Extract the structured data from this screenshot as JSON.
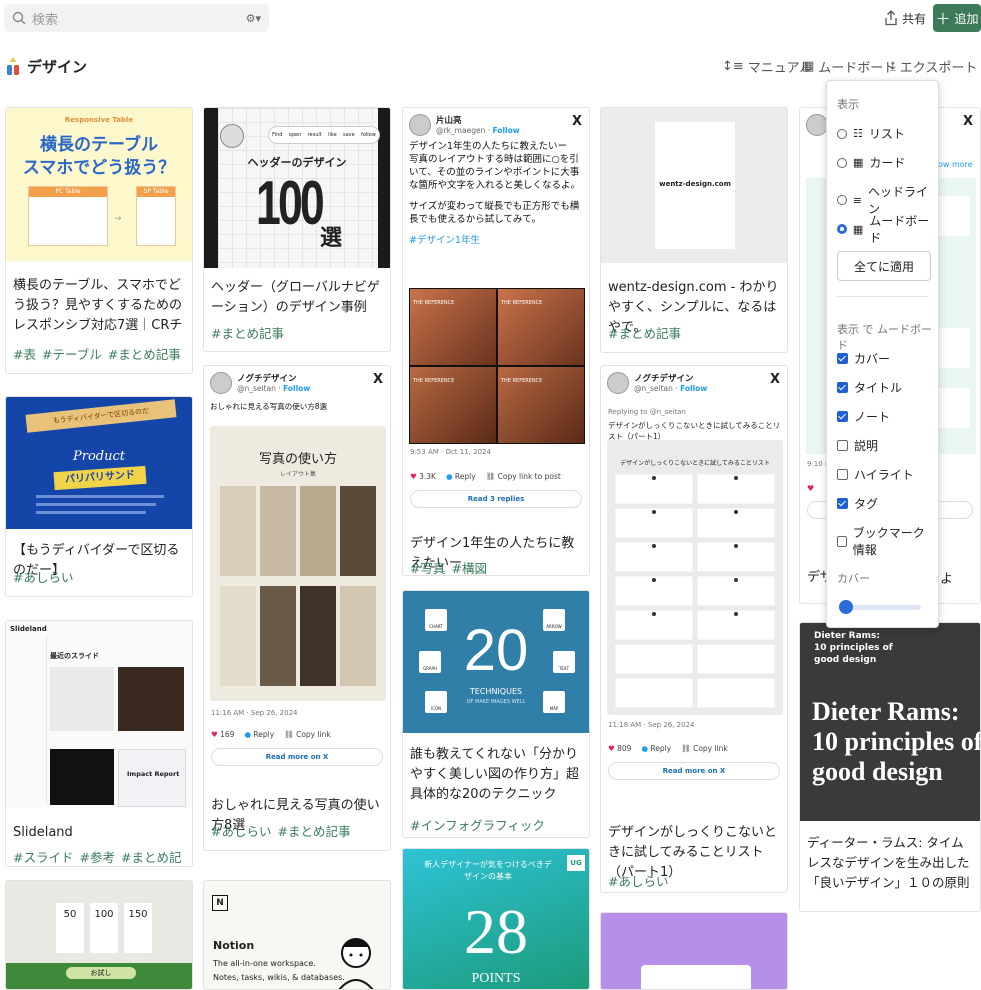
{
  "header": {
    "search_placeholder": "検索",
    "share_label": "共有",
    "add_label": "追加"
  },
  "page": {
    "title": "デザイン",
    "sort_label": "マニュアル",
    "view_label": "ムードボード",
    "export_label": "エクスポート"
  },
  "cards": {
    "c1": {
      "cover_small": "Responsive Table",
      "cover_big1": "横長のテーブル",
      "cover_big2": "スマホでどう扱う？",
      "cover_pc": "PC Table",
      "cover_sp": "SP Table",
      "title": "横長のテーブル、スマホでどう扱う？見やすくするためのレスポンシブ対応7選｜CRチーム@株式会社メタフェ...",
      "tags": [
        "#表",
        "#テーブル",
        "#まとめ記事"
      ]
    },
    "c2": {
      "cover_caption": "ヘッダーのデザイン",
      "cover_num": "100",
      "cover_suffix": "選",
      "nav": [
        "Find",
        "open",
        "result",
        "like",
        "save",
        "follow"
      ],
      "title": "ヘッダー（グローバルナビゲーション）のデザイン事例100選｜akane",
      "tags": [
        "#まとめ記事"
      ]
    },
    "c3": {
      "name": "片山亮",
      "handle": "@rk_maegen",
      "follow": "Follow",
      "text1": "デザイン1年生の人たちに教えたいー",
      "text2": "写真のレイアウトする時は範囲に○を引いて、その並のラインやポイントに大事な箇所や文字を入れると美しくなるよ。",
      "text3": "サイズが変わって縦長でも正方形でも横長でも使えるから試してみて。",
      "hashtag": "#デザイン1年生",
      "ref_label": "THE REFERENCE",
      "time": "9:53 AM · Oct 11, 2024",
      "likes": "3.3K",
      "reply": "Reply",
      "copy": "Copy link to post",
      "read": "Read 3 replies",
      "title": "デザイン1年生の人たちに教えたいー",
      "tags": [
        "#写真",
        "#構図"
      ]
    },
    "c4": {
      "cover_text": "wentz-design.com",
      "title": "wentz-design.com - わかりやすく、シンプルに、なるはやで。",
      "tags": [
        "#まとめ記事"
      ]
    },
    "c5": {
      "cover_top": "もうディバイダーで区切るのだ",
      "cover_product": "Product",
      "cover_badge": "パリパリサンド",
      "title": "【もうディバイダーで区切るのだー】",
      "tags": [
        "#あしらい"
      ]
    },
    "c6": {
      "name": "ノグチデザイン",
      "handle": "@n_seitan",
      "follow": "Follow",
      "text": "おしゃれに見える写真の使い方8選",
      "cover_title": "写真の使い方",
      "cover_sub": "レイアウト集",
      "time": "11:16 AM · Sep 26, 2024",
      "likes": "169",
      "reply": "Reply",
      "copy": "Copy link",
      "read": "Read more on X",
      "title": "おしゃれに見える写真の使い方8選",
      "tags": [
        "#あしらい",
        "#まとめ記事"
      ]
    },
    "c7": {
      "name": "ノグチデザイン",
      "handle": "@n_seitan",
      "follow": "Follow",
      "replying": "Replying to @n_seitan",
      "text": "デザインがしっくりこないときに試してみることリスト（パート1）",
      "sheet_title": "デザインがしっくりこないときに試してみることリスト",
      "time": "11:18 AM · Sep 26, 2024",
      "likes": "809",
      "reply": "Reply",
      "copy": "Copy link",
      "read": "Read more on X",
      "title": "デザインがしっくりこないときに試してみることリスト（パート1）",
      "tags": [
        "#あしらい"
      ]
    },
    "c8": {
      "brand": "Slideland",
      "heading": "最近のスライド",
      "impact": "Impact Report",
      "title": "Slideland",
      "tags": [
        "#スライド",
        "#参考",
        "#まとめ記事"
      ]
    },
    "c9": {
      "num": "20",
      "sub1": "TECHNIQUES",
      "sub2": "OF MAKE IMAGES WELL",
      "labels": [
        "CHART",
        "ARROW",
        "GRAPH",
        "TEXT",
        "ICON",
        "MAP"
      ],
      "title": "誰も教えてくれない「分かりやすく美しい図の作り方」超具体的な20のテクニック",
      "tags": [
        "#インフォグラフィック"
      ]
    },
    "c10": {
      "time": "9:10 PM",
      "title": "デザ",
      "title_end": "よ",
      "more": "ow more"
    },
    "c11": {
      "cover1": "Dieter Rams:",
      "cover2": "10 principles of",
      "cover3": "good design",
      "big1": "Dieter Rams:",
      "big2": "10 principles of",
      "big3": "good design",
      "title": "ディーター・ラムス: タイムレスなデザインを生み出した「良いデザイン」１０の原則"
    },
    "c12": {
      "prices": [
        "50",
        "100",
        "150"
      ],
      "label": "お試し"
    },
    "c13": {
      "brand": "Notion",
      "line1": "The all-in-one workspace.",
      "line2": "Notes, tasks, wikis, & databases."
    },
    "c14": {
      "top": "新人デザイナーが気をつけるべきデザインの基本",
      "badge": "UG",
      "num": "28",
      "points": "POINTS"
    }
  },
  "dropdown": {
    "display_heading": "表示",
    "layouts": [
      {
        "label": "リスト",
        "selected": false
      },
      {
        "label": "カード",
        "selected": false
      },
      {
        "label": "ヘッドライン",
        "selected": false
      },
      {
        "label": "ムードボード",
        "selected": true
      }
    ],
    "apply_label": "全てに適用",
    "show_heading_a": "表示 で",
    "show_heading_b": "ムードボード",
    "fields": [
      {
        "label": "カバー",
        "checked": true
      },
      {
        "label": "タイトル",
        "checked": true
      },
      {
        "label": "ノート",
        "checked": true
      },
      {
        "label": "説明",
        "checked": false
      },
      {
        "label": "ハイライト",
        "checked": false
      },
      {
        "label": "タグ",
        "checked": true
      },
      {
        "label": "ブックマーク 情報",
        "checked": false
      }
    ],
    "cover_heading": "カバー",
    "cover_size": 0.1
  },
  "colors": {
    "accent": "#3d7a5a",
    "tag": "#3a7d5c",
    "check": "#1f5fd1"
  }
}
